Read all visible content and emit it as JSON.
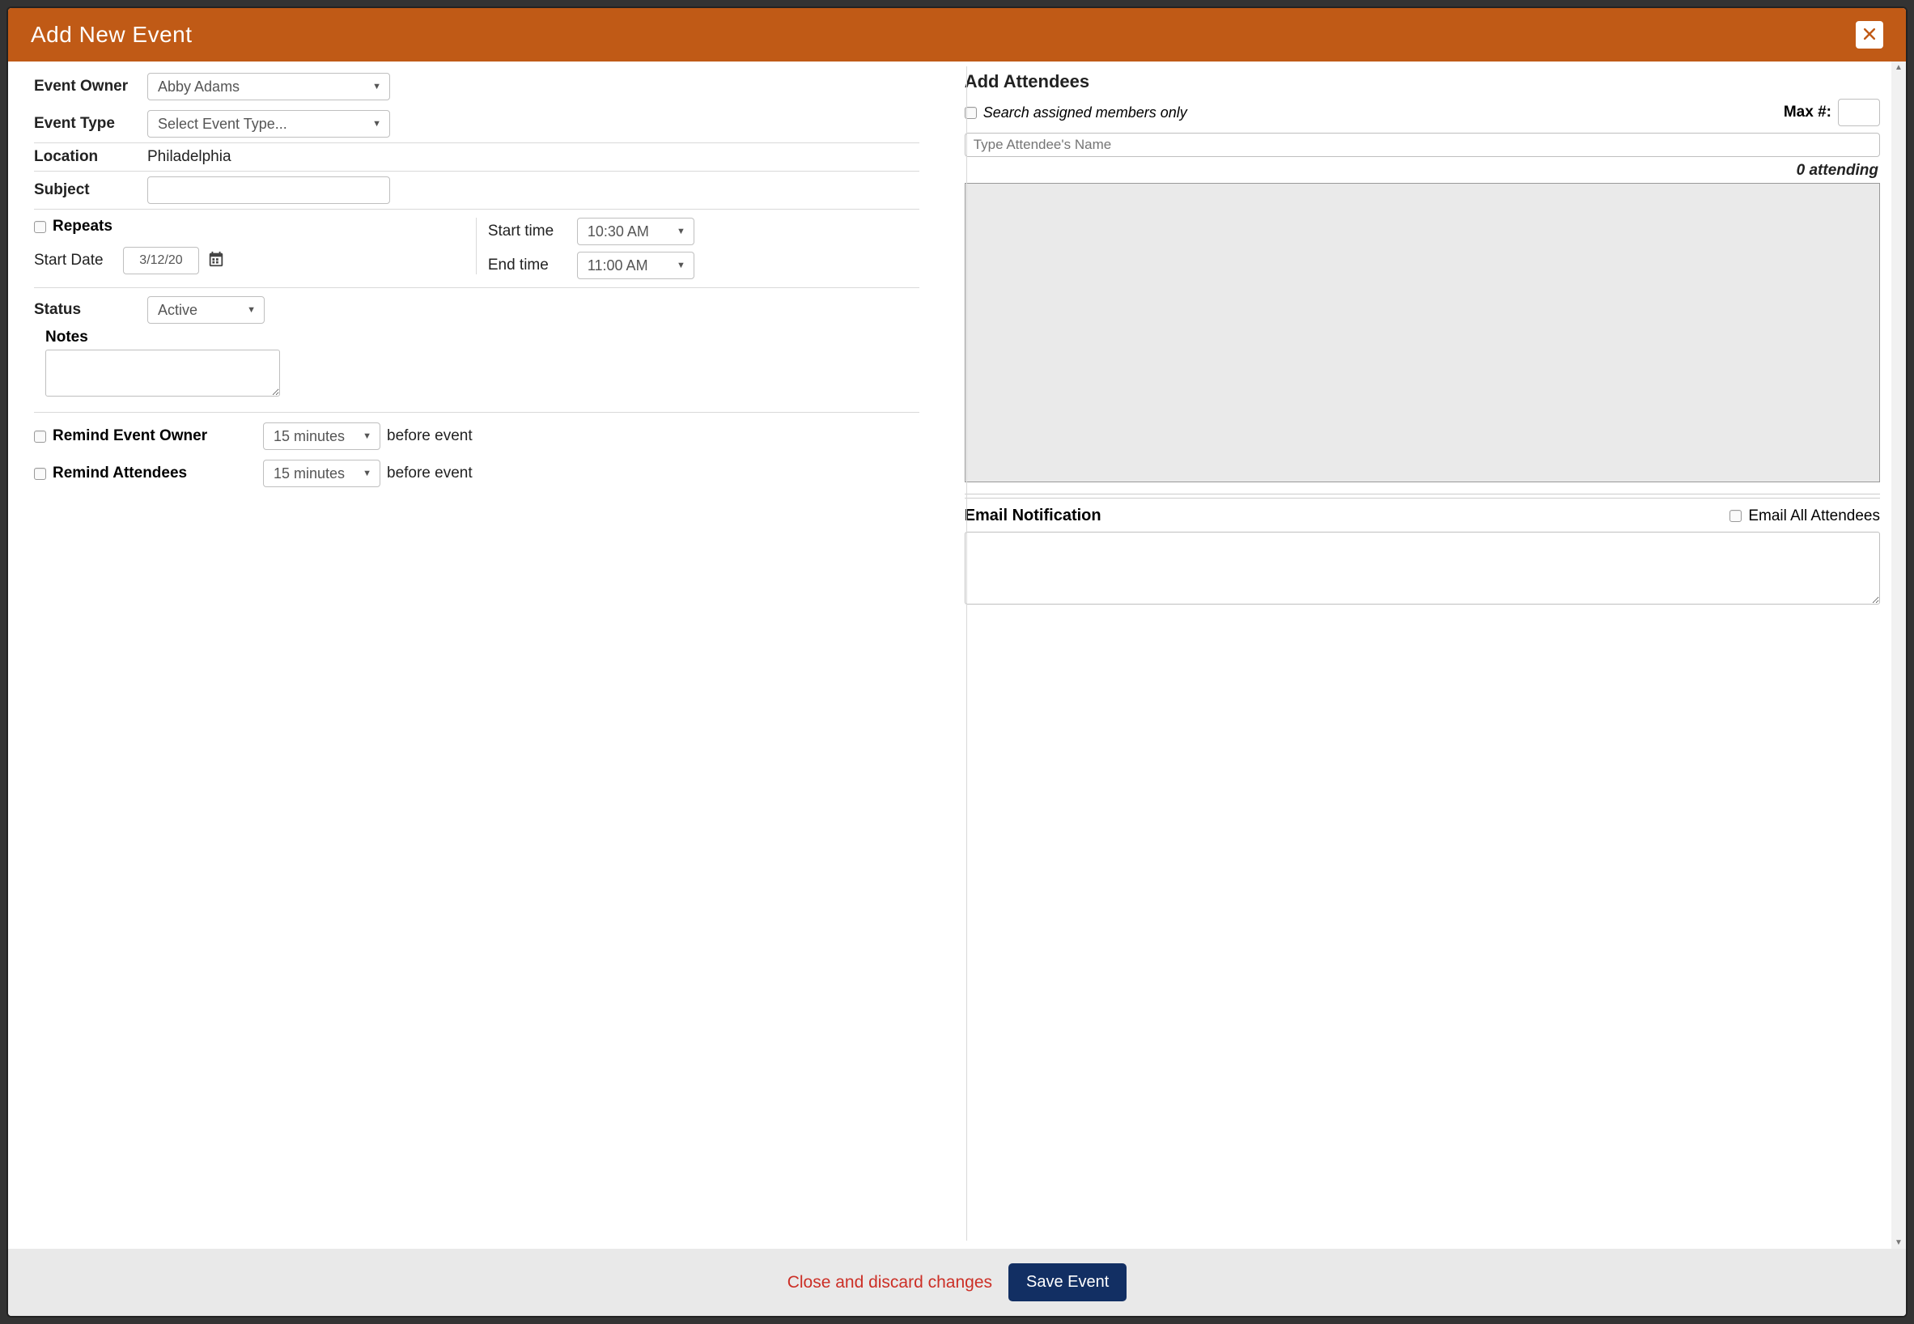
{
  "header": {
    "title": "Add New Event"
  },
  "left": {
    "labels": {
      "eventOwner": "Event Owner",
      "eventType": "Event Type",
      "location": "Location",
      "subject": "Subject",
      "repeats": "Repeats",
      "startDate": "Start Date",
      "startTime": "Start time",
      "endTime": "End time",
      "status": "Status",
      "notes": "Notes",
      "remindOwner": "Remind Event Owner",
      "remindAttendees": "Remind Attendees",
      "beforeEvent": "before event"
    },
    "values": {
      "eventOwner": "Abby Adams",
      "eventType": "Select Event Type...",
      "location": "Philadelphia",
      "subject": "",
      "startDate": "3/12/20",
      "startTime": "10:30 AM",
      "endTime": "11:00 AM",
      "status": "Active",
      "notes": "",
      "remindOwnerValue": "15 minutes",
      "remindAttendeesValue": "15 minutes"
    }
  },
  "right": {
    "labels": {
      "addAttendees": "Add Attendees",
      "searchAssigned": "Search assigned members only",
      "maxNum": "Max #:",
      "attendeePlaceholder": "Type Attendee's Name",
      "attendingCount": "0 attending",
      "emailNotification": "Email Notification",
      "emailAll": "Email All Attendees"
    },
    "values": {
      "maxNum": "",
      "attendeeSearch": "",
      "emailBody": ""
    }
  },
  "footer": {
    "discard": "Close and discard changes",
    "save": "Save Event"
  }
}
